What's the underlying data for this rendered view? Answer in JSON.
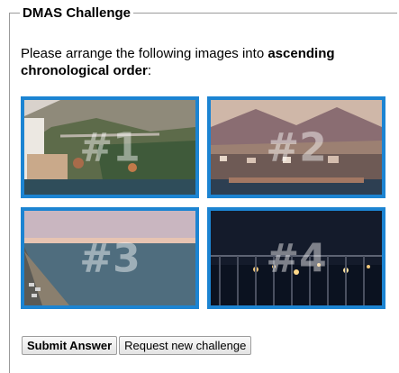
{
  "legend": "DMAS Challenge",
  "prompt": {
    "lead": "Please arrange the following images into ",
    "emph": "ascending chronological order",
    "tail": ":"
  },
  "images": [
    {
      "label": "#1",
      "desc": "coastal town with viaduct"
    },
    {
      "label": "#2",
      "desc": "harbor city with mountains"
    },
    {
      "label": "#3",
      "desc": "beach at sunset"
    },
    {
      "label": "#4",
      "desc": "city lights at night from balcony"
    }
  ],
  "buttons": {
    "submit": "Submit Answer",
    "request": "Request new challenge"
  },
  "colors": {
    "tile_border": "#1c84d2"
  }
}
